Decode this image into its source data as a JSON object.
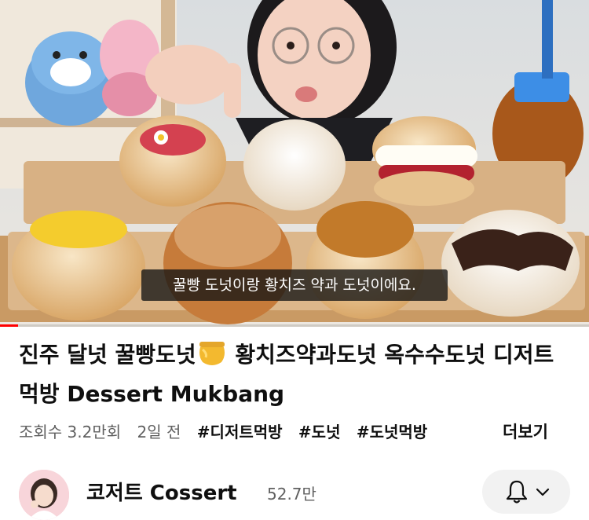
{
  "video": {
    "caption": "꿀빵 도넛이랑 황치즈 약과 도넛이에요.",
    "progress": 0.03,
    "progress_color": "#ff0000"
  },
  "title": {
    "part1": "진주 달넛 꿀빵도넛",
    "emoji_icon": "honey-pot-icon",
    "part2": " 황치즈약과도넛 옥수수도넛 디저트 먹방 Dessert Mukbang"
  },
  "meta": {
    "views": "조회수 3.2만회",
    "age": "2일 전",
    "tags": [
      "#디저트먹방",
      "#도넛",
      "#도넛먹방"
    ],
    "more": "더보기"
  },
  "channel": {
    "name": "코저트 Cossert",
    "subscribers": "52.7만",
    "avatar_icon": "channel-avatar",
    "notification_icon": "bell-icon",
    "dropdown_icon": "chevron-down-icon"
  }
}
